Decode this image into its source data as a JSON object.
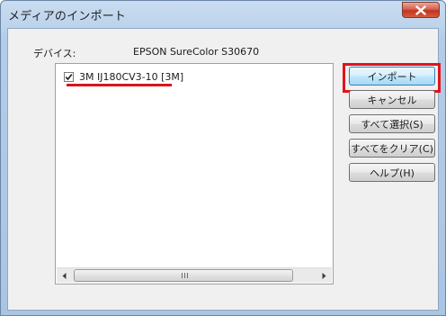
{
  "window": {
    "title": "メディアのインポート",
    "close_icon": "close-icon"
  },
  "device": {
    "label": "デバイス:",
    "value": "EPSON SureColor S30670"
  },
  "media_list": {
    "items": [
      {
        "label": "3M IJ180CV3-10 [3M]",
        "checked": true
      }
    ]
  },
  "scrollbar": {
    "grip_glyph": "III"
  },
  "buttons": {
    "import": "インポート",
    "cancel": "キャンセル",
    "select_all": "すべて選択(S)",
    "clear_all": "すべてをクリア(C)",
    "help": "ヘルプ(H)"
  },
  "colors": {
    "highlight": "#e0141b",
    "underline": "#d9141b",
    "titlebar": "#bcd3ec",
    "close_button": "#c3341f"
  }
}
